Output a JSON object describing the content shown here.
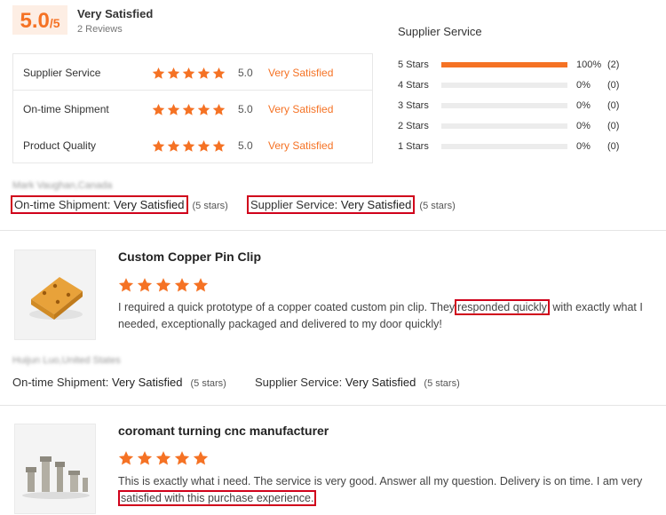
{
  "summary": {
    "score": "5.0",
    "score_max": "/5",
    "overall_label": "Very Satisfied",
    "review_count": "2 Reviews",
    "categories": [
      {
        "name": "Supplier Service",
        "score": "5.0",
        "verdict": "Very Satisfied"
      },
      {
        "name": "On-time Shipment",
        "score": "5.0",
        "verdict": "Very Satisfied"
      },
      {
        "name": "Product Quality",
        "score": "5.0",
        "verdict": "Very Satisfied"
      }
    ],
    "breakdown_title": "Supplier Service",
    "breakdown": [
      {
        "label": "5  Stars",
        "percent": "100%",
        "count": "(2)",
        "fill": 1.0
      },
      {
        "label": "4  Stars",
        "percent": "0%",
        "count": "(0)",
        "fill": 0
      },
      {
        "label": "3  Stars",
        "percent": "0%",
        "count": "(0)",
        "fill": 0
      },
      {
        "label": "2  Stars",
        "percent": "0%",
        "count": "(0)",
        "fill": 0
      },
      {
        "label": "1  Stars",
        "percent": "0%",
        "count": "(0)",
        "fill": 0
      }
    ]
  },
  "reviews": [
    {
      "reviewer": "Mark Vaughan,Canada",
      "shipment_label": "On-time Shipment:",
      "shipment_value": "Very Satisfied",
      "shipment_stars": "(5 stars)",
      "service_label": "Supplier Service:",
      "service_value": "Very Satisfied",
      "service_stars": "(5 stars)"
    },
    {
      "product": "Custom Copper Pin Clip",
      "rating": 5,
      "text_before": "I required a quick prototype of a copper coated custom pin clip.  They",
      "text_highlight": "responded quickly",
      "text_after": "with exactly what I needed, exceptionally packaged and delivered to my door quickly!",
      "reviewer": "Huijun Luo,United States",
      "shipment_label": "On-time Shipment:",
      "shipment_value": "Very Satisfied",
      "shipment_stars": "(5 stars)",
      "service_label": "Supplier Service:",
      "service_value": "Very Satisfied",
      "service_stars": "(5 stars)"
    },
    {
      "product": "coromant turning cnc manufacturer",
      "rating": 5,
      "text_before": "This is exactly what i need. The service is very good. Answer all my question. Delivery is on time. I am very",
      "text_highlight": "satisfied with this purchase experience.",
      "text_after": ""
    }
  ],
  "colors": {
    "accent": "#f57224",
    "highlight_border": "#d0021b"
  }
}
